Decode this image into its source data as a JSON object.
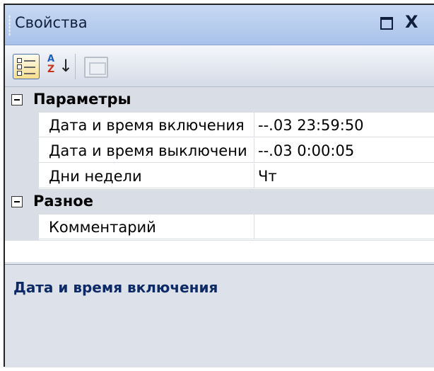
{
  "window": {
    "title": "Свойства",
    "float_icon": "float-window-icon",
    "close_glyph": "X"
  },
  "toolbar": {
    "categorized_icon": "categorized-view-icon",
    "alphabetical_icon": "alphabetical-sort-icon",
    "property_pages_icon": "property-pages-icon",
    "categorized_active": true
  },
  "grid": {
    "categories": [
      {
        "label": "Параметры",
        "properties": [
          {
            "name": "Дата и время включения",
            "value": "--.03 23:59:50"
          },
          {
            "name": "Дата и время выключени",
            "value": "--.03 0:00:05"
          },
          {
            "name": "Дни недели",
            "value": "Чт"
          }
        ]
      },
      {
        "label": "Разное",
        "properties": [
          {
            "name": "Комментарий",
            "value": ""
          }
        ]
      }
    ]
  },
  "help": {
    "title": "Дата и время включения"
  },
  "colors": {
    "title_bar": "#b7cdee",
    "category_background": "#d8dde6",
    "help_title": "#0e2a66"
  }
}
